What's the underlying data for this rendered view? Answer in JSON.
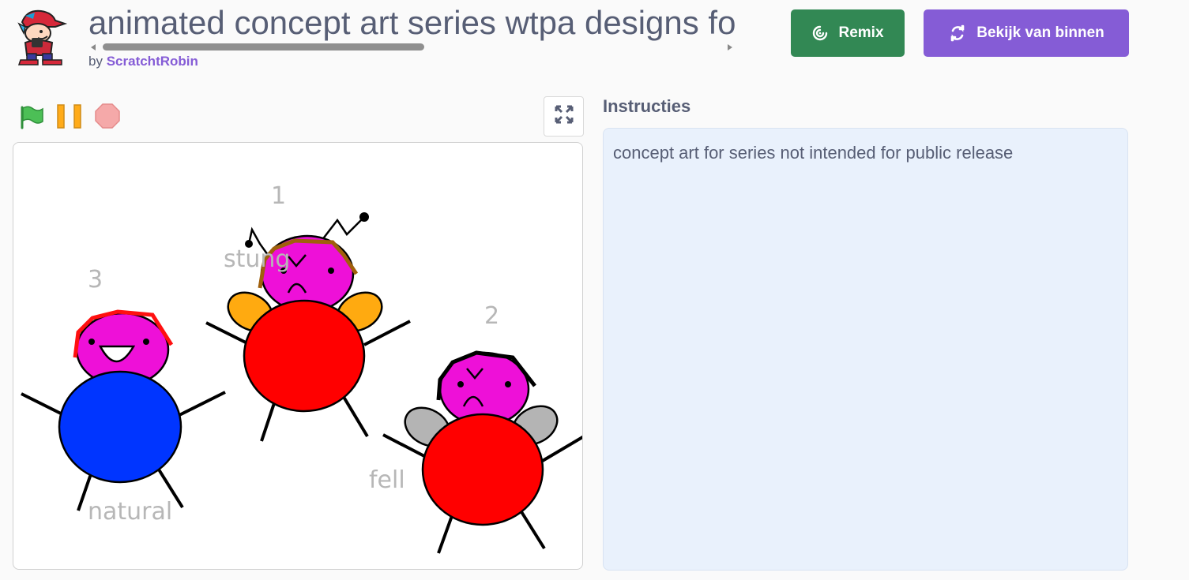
{
  "project": {
    "title": "animated concept art series wtpa designs fo",
    "by_prefix": "by",
    "author": "ScratchtRobin"
  },
  "buttons": {
    "remix_label": "Remix",
    "see_inside_label": "Bekijk van binnen"
  },
  "controls": {
    "icons": [
      "green-flag-icon",
      "pause-icon",
      "stop-icon",
      "fullscreen-icon"
    ]
  },
  "stage": {
    "labels": {
      "one": "1",
      "two": "2",
      "three": "3",
      "stung": "stung",
      "fell": "fell",
      "natural": "natural"
    }
  },
  "instructions": {
    "heading": "Instructies",
    "text": "concept art for series not intended for public release"
  },
  "colors": {
    "remix": "#328854",
    "see_inside": "#855cd6",
    "author_link": "#855cd6",
    "instructions_bg": "#e9f1fc"
  }
}
